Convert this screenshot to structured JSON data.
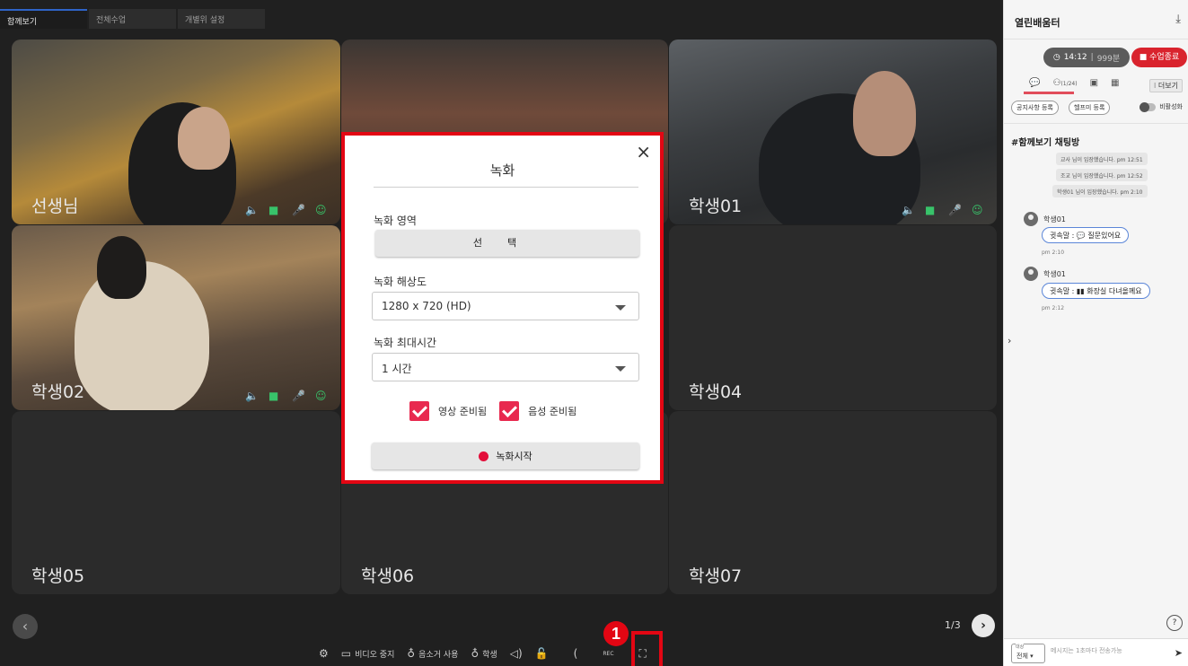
{
  "tabs": [
    "함께보기",
    "전체수업",
    "개별위 설정"
  ],
  "tiles": {
    "t1": "선생님",
    "t3": "학생01",
    "t4": "학생02",
    "t6": "학생04",
    "t7": "학생05",
    "t8": "학생06",
    "t9": "학생07"
  },
  "pager": {
    "info": "1/3",
    "prev": "‹",
    "next": "›"
  },
  "toolbar": {
    "video_stop": "비디오 중지",
    "mic_use": "음소거 사용",
    "student": "학생"
  },
  "badge": "1",
  "modal": {
    "title": "녹화",
    "area_label": "녹화 영역",
    "select_btn": "선택",
    "resolution_label": "녹화 해상도",
    "resolution_value": "1280 x 720 (HD)",
    "max_time_label": "녹화 최대시간",
    "max_time_value": "1 시간",
    "video_ready": "영상 준비됨",
    "audio_ready": "음성 준비됨",
    "start_btn": "녹화시작",
    "close": "×"
  },
  "panel": {
    "title": "열린배움터",
    "timer": "14:12",
    "timer_sub": "999분",
    "end_btn": "■ 수업종료",
    "people_count": "(1/24)",
    "more": "⁝ 더보기",
    "notice_btn": "공지사항 등록",
    "help_btn": "헬프미 등록",
    "toggle_label": "비활성화",
    "chat_title": "#함께보기 채팅방",
    "sys_msgs": [
      "교사 님이 입장했습니다. pm 12:51",
      "조교 님이 입장했습니다. pm 12:52",
      "학생01 님이 입장했습니다. pm 2:10"
    ],
    "chats": [
      {
        "user": "학생01",
        "text": "귓속말 : 💬 질문있어요",
        "time": "pm 2:10"
      },
      {
        "user": "학생01",
        "text": "귓속말 : ▮▮ 화장실 다녀올께요",
        "time": "pm 2:12"
      }
    ],
    "target_cap": "대상",
    "target_value": "전체 ▾",
    "input_placeholder": "메시지는 1초마다 전송가능",
    "help_icon": "?"
  }
}
